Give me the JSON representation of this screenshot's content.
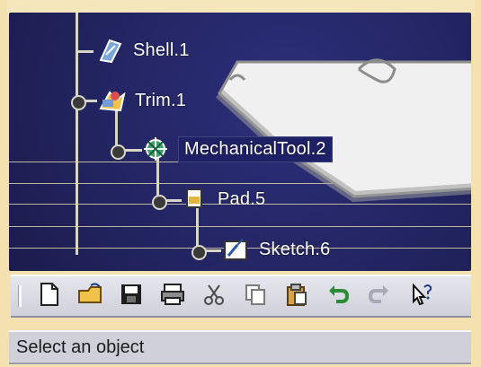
{
  "tree": {
    "nodes": [
      {
        "label": "Shell.1",
        "icon": "shell-icon"
      },
      {
        "label": "Trim.1",
        "icon": "trim-icon"
      },
      {
        "label": "MechanicalTool.2",
        "icon": "mechanical-tool-icon",
        "selected": true
      },
      {
        "label": "Pad.5",
        "icon": "pad-icon"
      },
      {
        "label": "Sketch.6",
        "icon": "sketch-icon"
      }
    ]
  },
  "toolbar": {
    "buttons": [
      {
        "name": "new-file",
        "icon": "new-file-icon"
      },
      {
        "name": "open-file",
        "icon": "open-folder-icon"
      },
      {
        "name": "save",
        "icon": "save-icon"
      },
      {
        "name": "print",
        "icon": "print-icon"
      },
      {
        "name": "cut",
        "icon": "scissors-icon"
      },
      {
        "name": "copy",
        "icon": "copy-icon"
      },
      {
        "name": "paste",
        "icon": "paste-icon"
      },
      {
        "name": "undo",
        "icon": "undo-icon"
      },
      {
        "name": "redo",
        "icon": "redo-icon"
      },
      {
        "name": "whats-this",
        "icon": "help-pointer-icon"
      }
    ]
  },
  "status": {
    "text": "Select an object"
  },
  "colors": {
    "viewport_bg": "#232563",
    "tree_line": "#d8d4c8",
    "label_text": "#ffffff",
    "toolbar_bg": "#d8d8e2",
    "paper_bg": "#f3e1b0"
  }
}
